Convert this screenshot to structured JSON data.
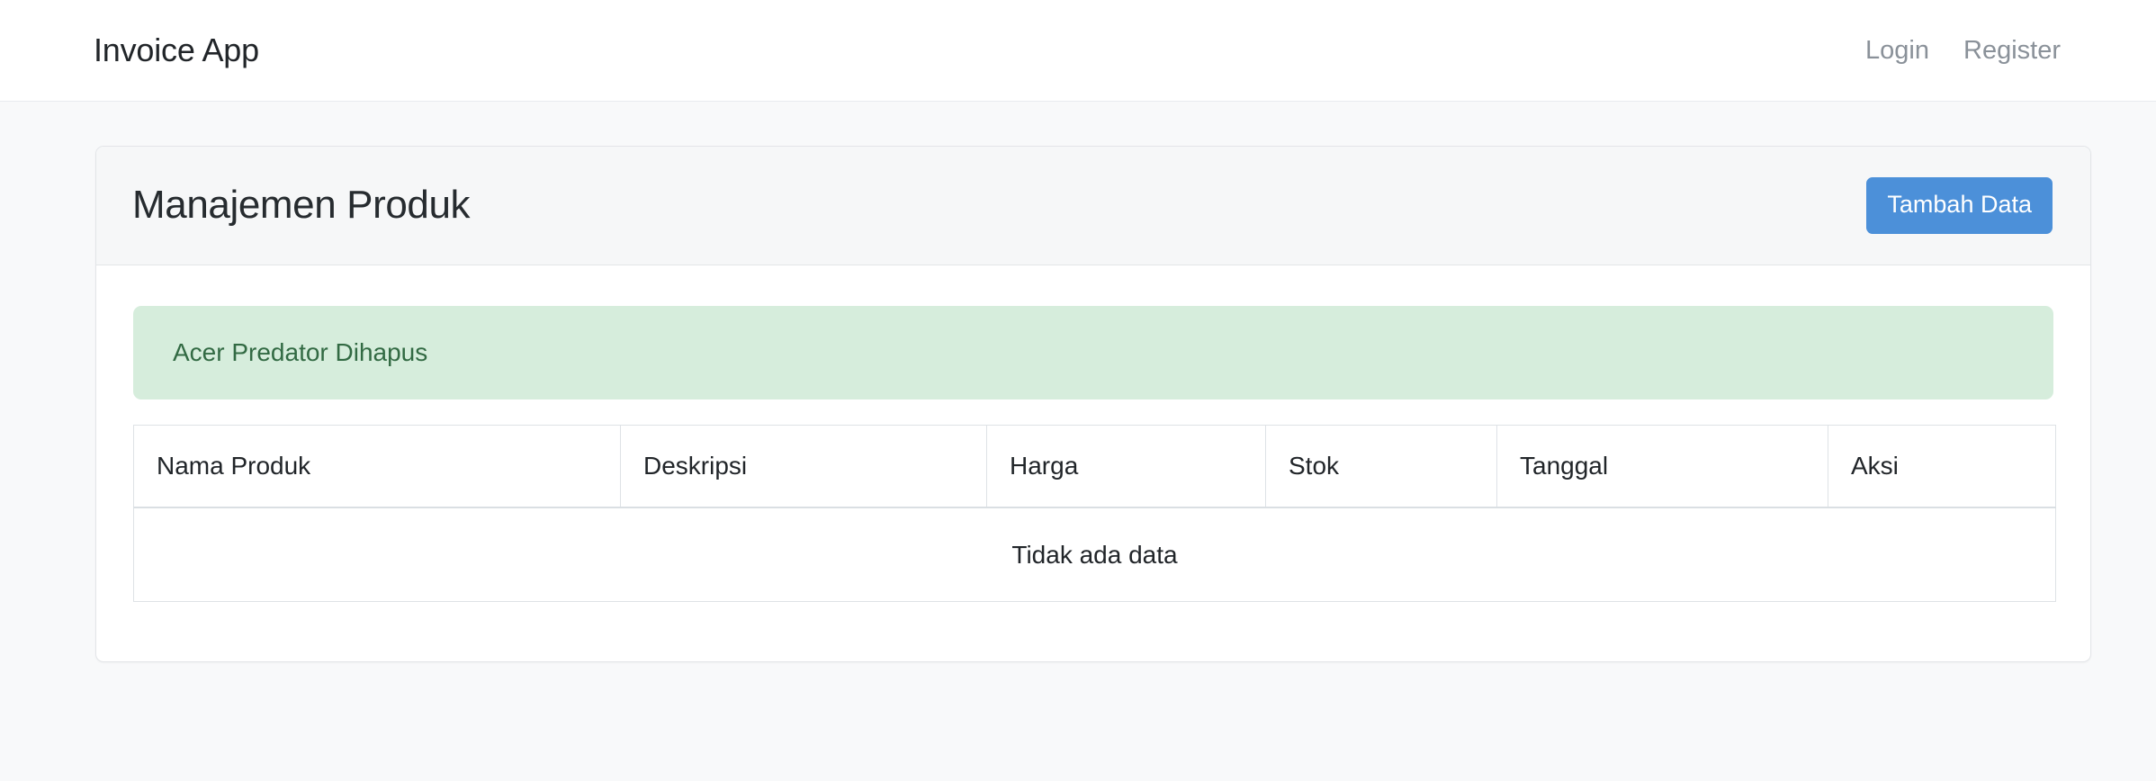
{
  "navbar": {
    "brand": "Invoice App",
    "links": [
      {
        "label": "Login",
        "name": "nav-link-login"
      },
      {
        "label": "Register",
        "name": "nav-link-register"
      }
    ]
  },
  "card": {
    "title": "Manajemen Produk",
    "add_button_label": "Tambah Data",
    "accent_color": "#4c90d9",
    "header_bg": "#f6f7f8"
  },
  "alert": {
    "message": "Acer Predator Dihapus",
    "type": "success",
    "bg_color": "#d6eddc",
    "text_color": "#326a43"
  },
  "table": {
    "columns": [
      "Nama Produk",
      "Deskripsi",
      "Harga",
      "Stok",
      "Tanggal",
      "Aksi"
    ],
    "rows": [],
    "empty_message": "Tidak ada data"
  },
  "page": {
    "background_color": "#f8f9fa"
  }
}
